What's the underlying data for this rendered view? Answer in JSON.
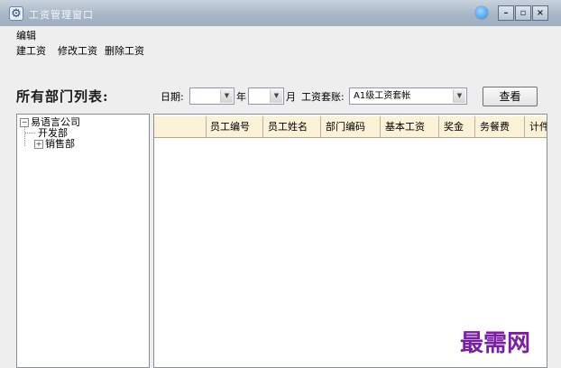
{
  "window": {
    "title": "工资管理窗口"
  },
  "icons": {
    "app": "salary-app-icon",
    "help": "help-icon",
    "minimize": "minimize-icon",
    "restore": "restore-icon",
    "close": "close-icon",
    "expand": "plus-icon",
    "collapse": "minus-icon",
    "dropdown": "chevron-down-icon"
  },
  "menu": {
    "edit": "编辑"
  },
  "toolbar": {
    "create": "建工资",
    "modify": "修改工资",
    "delete": "删除工资"
  },
  "sidebar": {
    "heading": "所有部门列表:",
    "tree": {
      "root": "易语言公司",
      "children": [
        {
          "label": "开发部"
        },
        {
          "label": "销售部"
        }
      ]
    }
  },
  "filters": {
    "date_label": "日期:",
    "year_value": "",
    "year_suffix": "年",
    "month_value": "",
    "month_suffix": "月",
    "ledger_label": "工资套账:",
    "ledger_value": "A1级工资套帐",
    "view_button": "查看"
  },
  "grid": {
    "columns": [
      "员工编号",
      "员工姓名",
      "部门编码",
      "基本工资",
      "奖金",
      "务餐费",
      "计件"
    ],
    "header_color": "#fbf2d7"
  },
  "watermark": "最需网",
  "colors": {
    "titlebar": "#a8b6c6",
    "background": "#eeeeee",
    "watermark": "#7b1fa2"
  }
}
